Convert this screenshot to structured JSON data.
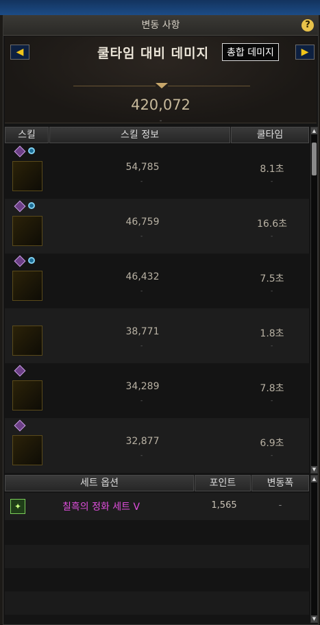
{
  "window": {
    "title": "변동 사항",
    "help_icon": "?"
  },
  "header": {
    "mode_title": "쿨타임 대비 데미지",
    "tooltip": "총합 데미지",
    "total": "420,072",
    "total_sub": "-",
    "left_arrow_icon": "◀",
    "right_arrow_icon": "▶"
  },
  "columns": {
    "skill": "스킬",
    "info": "스킬 정보",
    "cooldown": "쿨타임"
  },
  "skills": [
    {
      "value": "54,785",
      "value_sub": "-",
      "cooldown": "8.1초",
      "cooldown_sub": "-"
    },
    {
      "value": "46,759",
      "value_sub": "-",
      "cooldown": "16.6초",
      "cooldown_sub": "-"
    },
    {
      "value": "46,432",
      "value_sub": "-",
      "cooldown": "7.5초",
      "cooldown_sub": "-"
    },
    {
      "value": "38,771",
      "value_sub": "-",
      "cooldown": "1.8초",
      "cooldown_sub": "-"
    },
    {
      "value": "34,289",
      "value_sub": "-",
      "cooldown": "7.8초",
      "cooldown_sub": "-"
    },
    {
      "value": "32,877",
      "value_sub": "-",
      "cooldown": "6.9초",
      "cooldown_sub": "-"
    }
  ],
  "set_section": {
    "col_option": "세트 옵션",
    "col_point": "포인트",
    "col_delta": "변동폭",
    "row": {
      "name": "칠흑의 정화 세트 V",
      "point": "1,565",
      "delta": "-"
    }
  },
  "colors": {
    "accent": "#f0c419",
    "set_name": "#e34fe0",
    "arrow_bg": "#0d2040"
  }
}
